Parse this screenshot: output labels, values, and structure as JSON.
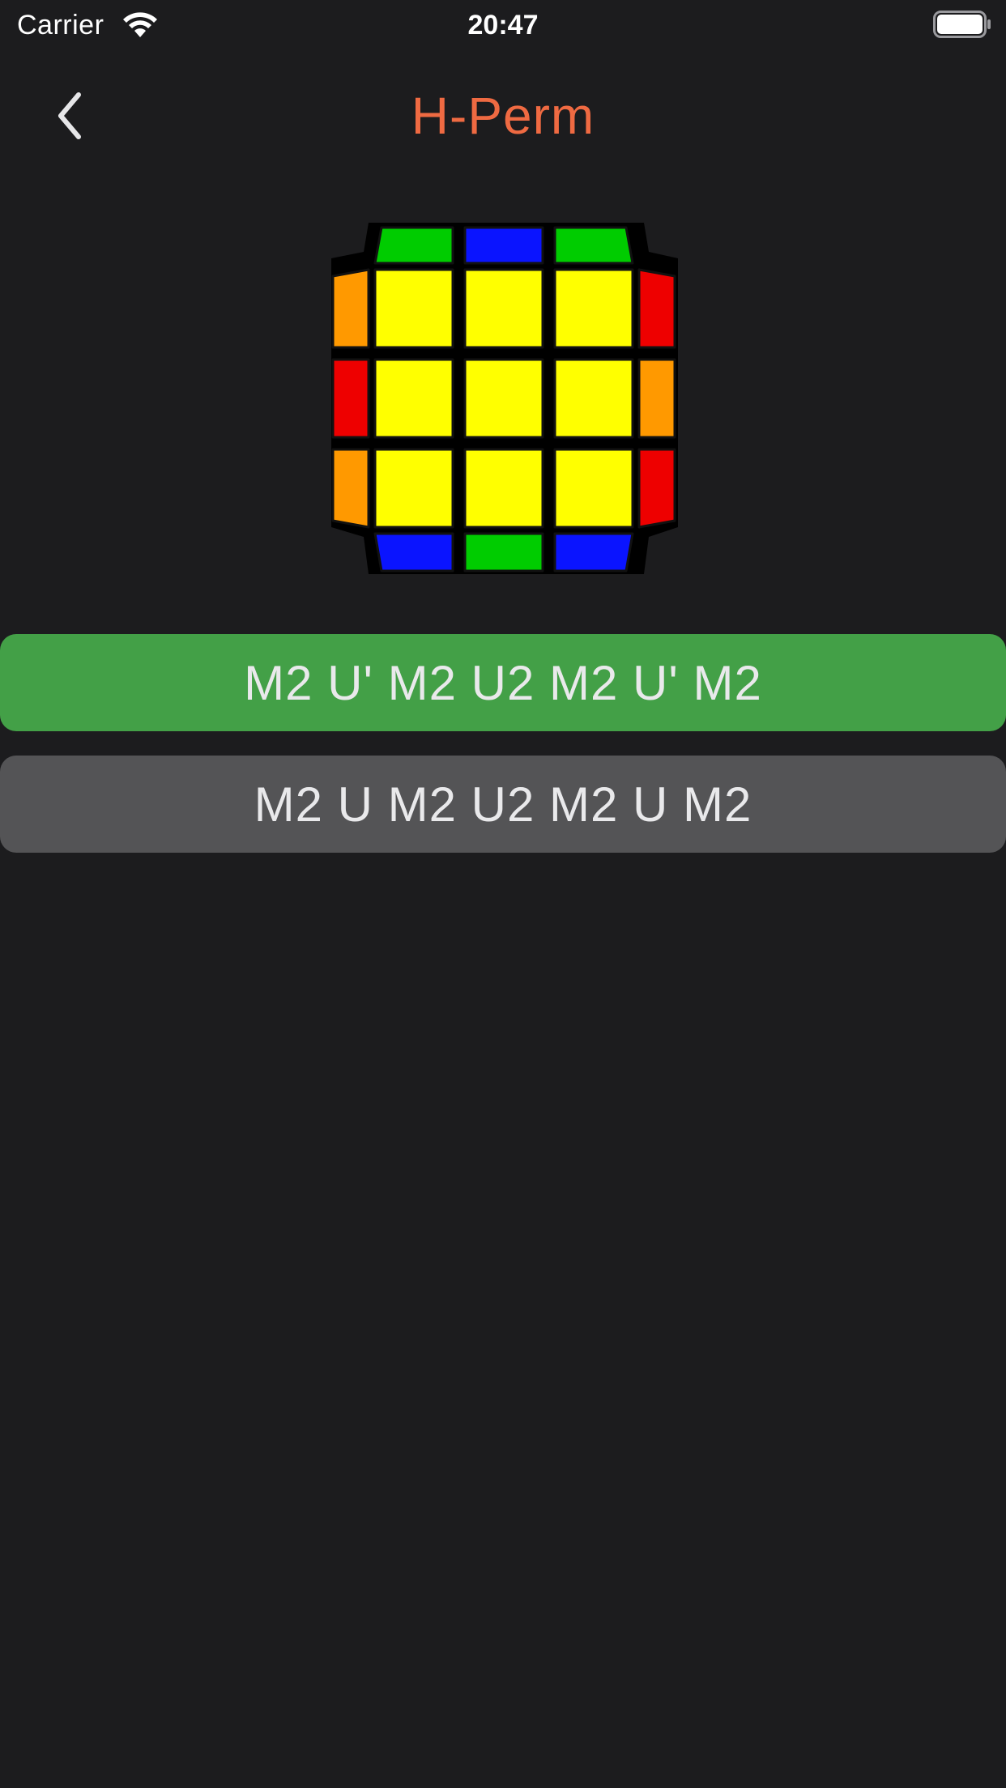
{
  "status_bar": {
    "carrier": "Carrier",
    "time": "20:47",
    "wifi_icon": "wifi-icon",
    "battery_icon": "battery-full-icon"
  },
  "nav": {
    "back_icon": "chevron-left-icon",
    "title": "H-Perm",
    "title_color": "#ef6a42"
  },
  "cube": {
    "top_face": [
      [
        "yellow",
        "yellow",
        "yellow"
      ],
      [
        "yellow",
        "yellow",
        "yellow"
      ],
      [
        "yellow",
        "yellow",
        "yellow"
      ]
    ],
    "back_edge": [
      "green",
      "blue",
      "green"
    ],
    "front_edge": [
      "blue",
      "green",
      "blue"
    ],
    "left_edge": [
      "orange",
      "red",
      "orange"
    ],
    "right_edge": [
      "red",
      "orange",
      "red"
    ],
    "colors": {
      "yellow": "#ffff00",
      "green": "#00cc00",
      "blue": "#0a14ff",
      "red": "#ee0000",
      "orange": "#ff9900"
    }
  },
  "algorithms": [
    {
      "text": "M2 U' M2 U2 M2 U' M2",
      "selected": true,
      "color": "#43a047"
    },
    {
      "text": "M2 U M2 U2 M2 U M2",
      "selected": false,
      "color": "#545456"
    }
  ]
}
